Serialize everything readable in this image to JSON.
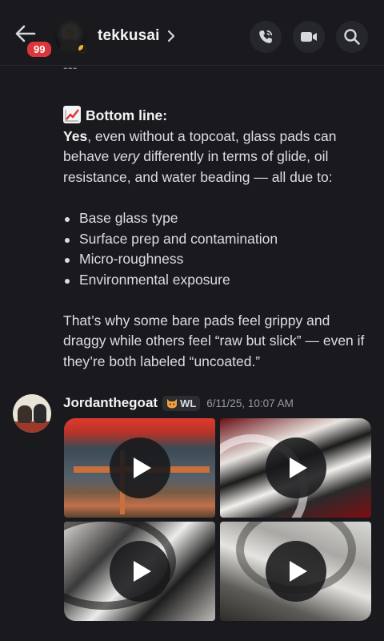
{
  "header": {
    "unread_count": "99",
    "user_name": "tekkusai"
  },
  "message1": {
    "separator": "---",
    "heading": "Bottom line:",
    "para_bold": "Yes",
    "para_before_em": ", even without a topcoat, glass pads can behave ",
    "para_em": "very",
    "para_after_em": " differently in terms of glide, oil resistance, and water beading — all due to:",
    "bullets": [
      "Base glass type",
      "Surface prep and contamination",
      "Micro-roughness",
      "Environmental exposure"
    ],
    "closing": "That’s why some bare pads feel grippy and draggy while others feel “raw but slick” — even if they’re both labeled “uncoated.”"
  },
  "message2": {
    "author": "Jordanthegoat",
    "tag": "WL",
    "timestamp": "6/11/25, 10:07 AM"
  },
  "colors": {
    "background": "#1a1a1e",
    "badge_red": "#da373c",
    "icon_button_bg": "#26272b"
  }
}
